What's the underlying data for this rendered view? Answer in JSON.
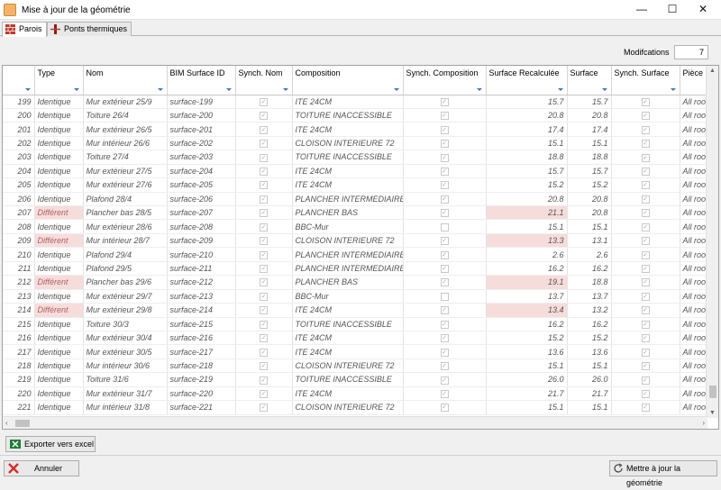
{
  "window": {
    "title": "Mise à jour de la géométrie",
    "minimize": "—",
    "maximize": "☐",
    "close": "✕"
  },
  "tabs": [
    {
      "label": "Parois",
      "icon": "wall-icon"
    },
    {
      "label": "Ponts thermiques",
      "icon": "thermal-bridge-icon"
    }
  ],
  "modifications": {
    "label": "Modifcations",
    "value": "7"
  },
  "columns": [
    "",
    "Type",
    "Nom",
    "BIM Surface ID",
    "Synch. Nom",
    "Composition",
    "Synch. Composition",
    "Surface Recalculée",
    "Surface",
    "Synch. Surface",
    "Pièce"
  ],
  "rows": [
    {
      "n": "199",
      "type": "Identique",
      "nom": "Mur extérieur 25/9",
      "bim": "surface-199",
      "sn": true,
      "comp": "ITE 24CM",
      "sc": true,
      "sr": "15.7",
      "s": "15.7",
      "ss": true,
      "p": "All roo"
    },
    {
      "n": "200",
      "type": "Identique",
      "nom": "Toiture 26/4",
      "bim": "surface-200",
      "sn": true,
      "comp": "TOITURE INACCESSIBLE",
      "sc": true,
      "sr": "20.8",
      "s": "20.8",
      "ss": true,
      "p": "All roo"
    },
    {
      "n": "201",
      "type": "Identique",
      "nom": "Mur extérieur 26/5",
      "bim": "surface-201",
      "sn": true,
      "comp": "ITE 24CM",
      "sc": true,
      "sr": "17.4",
      "s": "17.4",
      "ss": true,
      "p": "All roo"
    },
    {
      "n": "202",
      "type": "Identique",
      "nom": "Mur intérieur 26/6",
      "bim": "surface-202",
      "sn": true,
      "comp": "CLOISON INTERIEURE 72",
      "sc": true,
      "sr": "15.1",
      "s": "15.1",
      "ss": true,
      "p": "All roo"
    },
    {
      "n": "203",
      "type": "Identique",
      "nom": "Toiture 27/4",
      "bim": "surface-203",
      "sn": true,
      "comp": "TOITURE INACCESSIBLE",
      "sc": true,
      "sr": "18.8",
      "s": "18.8",
      "ss": true,
      "p": "All roo"
    },
    {
      "n": "204",
      "type": "Identique",
      "nom": "Mur extérieur 27/5",
      "bim": "surface-204",
      "sn": true,
      "comp": "ITE 24CM",
      "sc": true,
      "sr": "15.7",
      "s": "15.7",
      "ss": true,
      "p": "All roo"
    },
    {
      "n": "205",
      "type": "Identique",
      "nom": "Mur extérieur 27/6",
      "bim": "surface-205",
      "sn": true,
      "comp": "ITE 24CM",
      "sc": true,
      "sr": "15.2",
      "s": "15.2",
      "ss": true,
      "p": "All roo"
    },
    {
      "n": "206",
      "type": "Identique",
      "nom": "Plafond 28/4",
      "bim": "surface-206",
      "sn": true,
      "comp": "PLANCHER INTERMEDIAIRE",
      "sc": true,
      "sr": "20.8",
      "s": "20.8",
      "ss": true,
      "p": "All roo"
    },
    {
      "n": "207",
      "type": "Différent",
      "nom": "Plancher bas 28/5",
      "bim": "surface-207",
      "sn": true,
      "comp": "PLANCHER BAS",
      "sc": true,
      "sr": "21.1",
      "s": "20.8",
      "ss": true,
      "p": "All roo",
      "diff": true
    },
    {
      "n": "208",
      "type": "Identique",
      "nom": "Mur extérieur 28/6",
      "bim": "surface-208",
      "sn": true,
      "comp": "BBC-Mur",
      "sc": false,
      "sr": "15.1",
      "s": "15.1",
      "ss": true,
      "p": "All roo"
    },
    {
      "n": "209",
      "type": "Différent",
      "nom": "Mur intérieur 28/7",
      "bim": "surface-209",
      "sn": true,
      "comp": "CLOISON INTERIEURE 72",
      "sc": true,
      "sr": "13.3",
      "s": "13.1",
      "ss": true,
      "p": "All roo",
      "diff": true
    },
    {
      "n": "210",
      "type": "Identique",
      "nom": "Plafond 29/4",
      "bim": "surface-210",
      "sn": true,
      "comp": "PLANCHER INTERMEDIAIRE",
      "sc": true,
      "sr": "2.6",
      "s": "2.6",
      "ss": true,
      "p": "All roo"
    },
    {
      "n": "211",
      "type": "Identique",
      "nom": "Plafond 29/5",
      "bim": "surface-211",
      "sn": true,
      "comp": "PLANCHER INTERMEDIAIRE",
      "sc": true,
      "sr": "16.2",
      "s": "16.2",
      "ss": true,
      "p": "All roo"
    },
    {
      "n": "212",
      "type": "Différent",
      "nom": "Plancher bas 29/6",
      "bim": "surface-212",
      "sn": true,
      "comp": "PLANCHER BAS",
      "sc": true,
      "sr": "19.1",
      "s": "18.8",
      "ss": true,
      "p": "All roo",
      "diff": true
    },
    {
      "n": "213",
      "type": "Identique",
      "nom": "Mur extérieur 29/7",
      "bim": "surface-213",
      "sn": true,
      "comp": "BBC-Mur",
      "sc": false,
      "sr": "13.7",
      "s": "13.7",
      "ss": true,
      "p": "All roo"
    },
    {
      "n": "214",
      "type": "Différent",
      "nom": "Mur extérieur 29/8",
      "bim": "surface-214",
      "sn": true,
      "comp": "ITE 24CM",
      "sc": true,
      "sr": "13.4",
      "s": "13.2",
      "ss": true,
      "p": "All roo",
      "diff": true
    },
    {
      "n": "215",
      "type": "Identique",
      "nom": "Toiture 30/3",
      "bim": "surface-215",
      "sn": true,
      "comp": "TOITURE INACCESSIBLE",
      "sc": true,
      "sr": "16.2",
      "s": "16.2",
      "ss": true,
      "p": "All roo"
    },
    {
      "n": "216",
      "type": "Identique",
      "nom": "Mur extérieur 30/4",
      "bim": "surface-216",
      "sn": true,
      "comp": "ITE 24CM",
      "sc": true,
      "sr": "15.2",
      "s": "15.2",
      "ss": true,
      "p": "All roo"
    },
    {
      "n": "217",
      "type": "Identique",
      "nom": "Mur extérieur 30/5",
      "bim": "surface-217",
      "sn": true,
      "comp": "ITE 24CM",
      "sc": true,
      "sr": "13.6",
      "s": "13.6",
      "ss": true,
      "p": "All roo"
    },
    {
      "n": "218",
      "type": "Identique",
      "nom": "Mur intérieur 30/6",
      "bim": "surface-218",
      "sn": true,
      "comp": "CLOISON INTERIEURE 72",
      "sc": true,
      "sr": "15.1",
      "s": "15.1",
      "ss": true,
      "p": "All roo"
    },
    {
      "n": "219",
      "type": "Identique",
      "nom": "Toiture 31/6",
      "bim": "surface-219",
      "sn": true,
      "comp": "TOITURE INACCESSIBLE",
      "sc": true,
      "sr": "26.0",
      "s": "26.0",
      "ss": true,
      "p": "All roo"
    },
    {
      "n": "220",
      "type": "Identique",
      "nom": "Mur extérieur 31/7",
      "bim": "surface-220",
      "sn": true,
      "comp": "ITE 24CM",
      "sc": true,
      "sr": "21.7",
      "s": "21.7",
      "ss": true,
      "p": "All roo"
    },
    {
      "n": "221",
      "type": "Identique",
      "nom": "Mur intérieur 31/8",
      "bim": "surface-221",
      "sn": true,
      "comp": "CLOISON INTERIEURE 72",
      "sc": true,
      "sr": "15.1",
      "s": "15.1",
      "ss": true,
      "p": "All roo"
    }
  ],
  "export_button": {
    "label": "Exporter vers excel",
    "icon": "excel-icon"
  },
  "cancel_button": {
    "label": "Annuler",
    "icon": "close-icon"
  },
  "update_button": {
    "label": "Mettre à jour la géométrie",
    "icon": "refresh-icon"
  },
  "colors": {
    "diff_bg": "#f7dcdc",
    "filter": "#3a78c4"
  },
  "scroll": {
    "up": "▲",
    "down": "▼",
    "left": "‹",
    "right": "›"
  },
  "check_mark": "✓"
}
